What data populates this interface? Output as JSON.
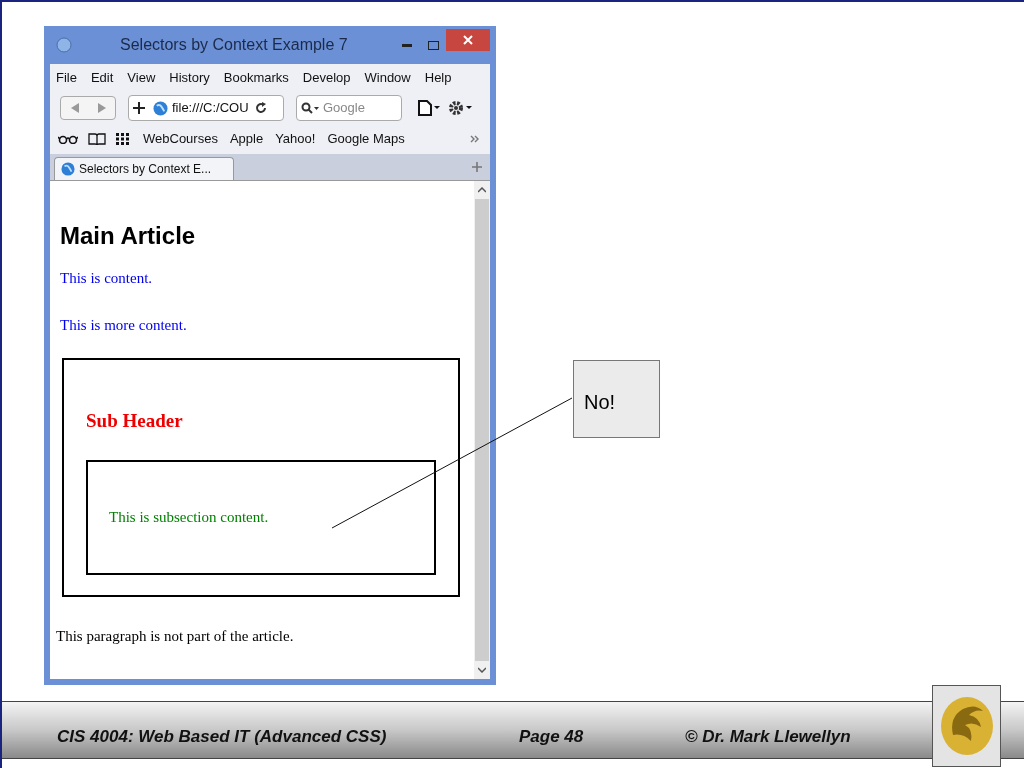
{
  "browser": {
    "window_title": "Selectors by Context Example 7",
    "menu": [
      "File",
      "Edit",
      "View",
      "History",
      "Bookmarks",
      "Develop",
      "Window",
      "Help"
    ],
    "address": "file:///C:/COU",
    "search": {
      "placeholder": "Google"
    },
    "bookmarks": [
      "WebCourses",
      "Apple",
      "Yahoo!",
      "Google Maps"
    ],
    "tabs": [
      {
        "label": "Selectors by Context E...",
        "selected": true
      }
    ],
    "page": {
      "heading": "Main Article",
      "paragraphs": [
        "This is content.",
        "This is more content."
      ],
      "section": {
        "header": "Sub Header",
        "subsection": "This is subsection content."
      },
      "after": "This paragraph is not part of the article."
    }
  },
  "callout": "No!",
  "footer": {
    "course": "CIS 4004: Web Based IT (Advanced CSS)",
    "page": "Page 48",
    "author": "© Dr. Mark Llewellyn"
  }
}
